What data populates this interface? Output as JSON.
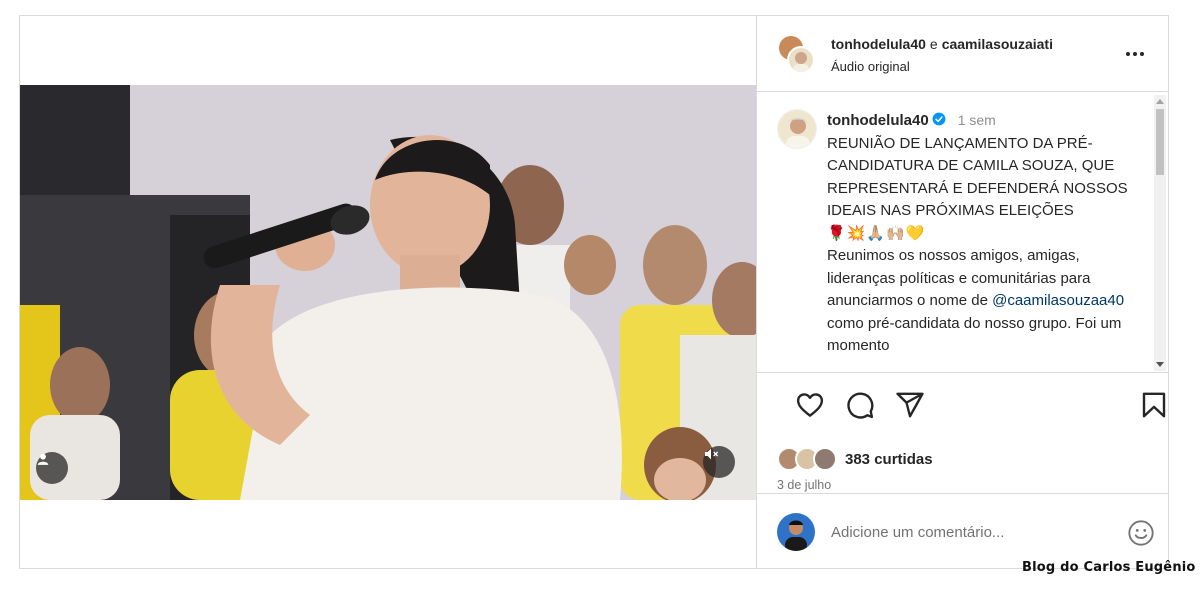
{
  "header": {
    "user1": "tonhodelula40",
    "joiner": "e",
    "user2": "caamilasouzaiati",
    "audio": "Áudio original",
    "more_icon": "more-horizontal-icon"
  },
  "caption": {
    "username": "tonhodelula40",
    "time": "1 sem",
    "title": "REUNIÃO DE LANÇAMENTO DA PRÉ-CANDIDATURA DE CAMILA SOUZA, QUE REPRESENTARÁ E DEFENDERÁ NOSSOS IDEAIS NAS PRÓXIMAS ELEIÇÕES",
    "emojis": "🌹💥🙏🏼🙌🏼💛",
    "body_1": "Reunimos os nossos amigos, amigas, lideranças políticas e comunitárias para anunciarmos o nome de",
    "mention": "@caamilasouzaa40",
    "body_2": "como pré-candidata do nosso grupo. Foi um momento"
  },
  "actions": {
    "like_icon": "heart-icon",
    "comment_icon": "comment-icon",
    "share_icon": "share-icon",
    "save_icon": "bookmark-icon",
    "likes": "383 curtidas",
    "date": "3 de julho"
  },
  "comment": {
    "placeholder": "Adicione um comentário...",
    "emoji_icon": "emoji-icon"
  },
  "video": {
    "user_tag_icon": "user-tag-icon",
    "mute_icon": "muted-speaker-icon"
  },
  "watermark": "Blog do Carlos Eugênio",
  "colors": {
    "border": "#dbdbdb",
    "text": "#262626",
    "muted": "#737373",
    "link": "#00376b",
    "verified": "#0095f6"
  }
}
